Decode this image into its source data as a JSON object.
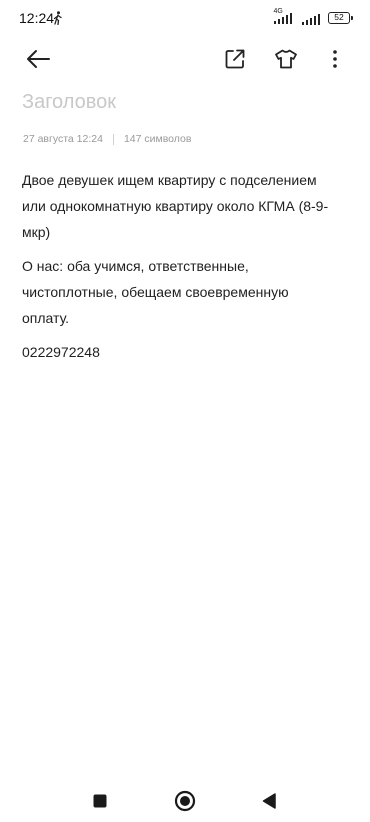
{
  "status_bar": {
    "time": "12:24",
    "network_label": "4G",
    "battery": "52"
  },
  "toolbar": {
    "icons": [
      "arrow-left-icon",
      "share-external-icon",
      "tshirt-theme-icon",
      "more-vertical-icon"
    ]
  },
  "note": {
    "title_placeholder": "Заголовок",
    "date": "27 августа 12:24",
    "char_count": "147 символов",
    "paragraphs": [
      [
        "Двое девушек ищем квартиру с подселением",
        "или однокомнатную квартиру около КГМА (8-9-",
        "мкр)"
      ],
      [
        "О нас: оба учимся, ответственные,",
        "чистоплотные, обещаем своевременную",
        "оплату."
      ],
      [
        "0222972248"
      ]
    ]
  },
  "navigation_bar": {
    "icons": [
      "recents-square-icon",
      "home-circle-icon",
      "back-triangle-icon"
    ]
  }
}
